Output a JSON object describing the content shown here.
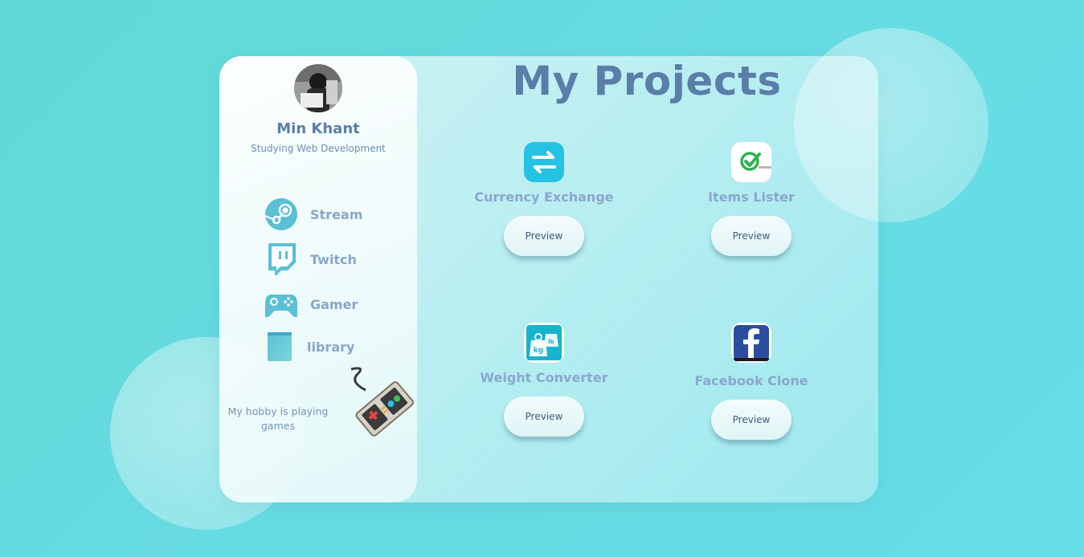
{
  "profile": {
    "name": "Min Khant",
    "role": "Studying Web Development"
  },
  "nav": [
    {
      "label": "Stream",
      "icon": "steam-icon"
    },
    {
      "label": "Twitch",
      "icon": "twitch-icon"
    },
    {
      "label": "Gamer",
      "icon": "gamepad-icon"
    },
    {
      "label": "library",
      "icon": "book-icon"
    }
  ],
  "hobby": "My hobby is playing games",
  "main": {
    "title": "My Projects",
    "projects": [
      {
        "title": "Currency Exchange",
        "button": "Preview",
        "icon": "exchange-icon"
      },
      {
        "title": "Items Lister",
        "button": "Preview",
        "icon": "checkmark-icon"
      },
      {
        "title": "Weight Converter",
        "button": "Preview",
        "icon": "weight-icon"
      },
      {
        "title": "Facebook Clone",
        "button": "Preview",
        "icon": "facebook-icon"
      }
    ]
  },
  "colors": {
    "background": "#64dadd",
    "accent_text": "#5a7ea8",
    "icon_teal": "#5bc3d6"
  }
}
